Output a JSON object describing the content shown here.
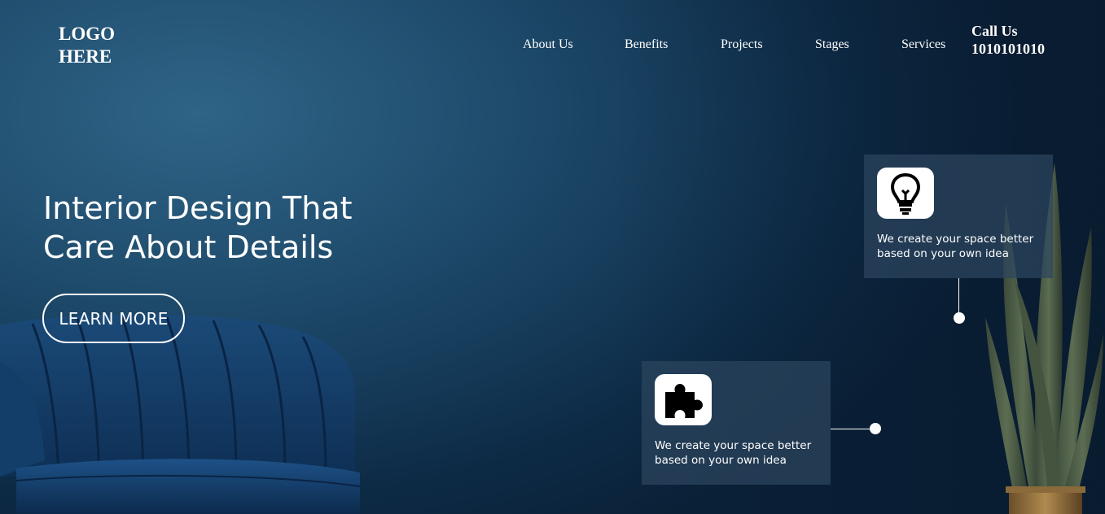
{
  "header": {
    "logo_line1": "LOGO",
    "logo_line2": "HERE",
    "nav": [
      "About Us",
      "Benefits",
      "Projects",
      "Stages",
      "Services"
    ],
    "call_label": "Call Us",
    "call_number": "1010101010"
  },
  "hero": {
    "title_line1": "Interior Design That",
    "title_line2": "Care About Details",
    "cta_label": "LEARN MORE"
  },
  "cards": [
    {
      "icon": "lightbulb-icon",
      "text_line1": "We create your space better",
      "text_line2": "based on your own idea"
    },
    {
      "icon": "puzzle-icon",
      "text_line1": "We create your space better",
      "text_line2": "based on your own idea"
    }
  ],
  "colors": {
    "background_light": "#2f6487",
    "background_dark": "#0a2138",
    "card_bg": "#2c455e",
    "text": "#ffffff"
  }
}
